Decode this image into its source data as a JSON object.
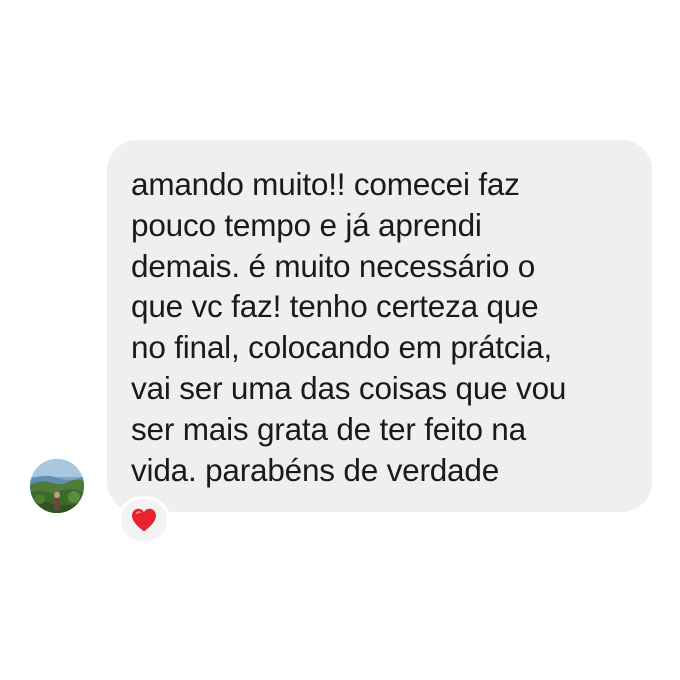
{
  "message": {
    "lines": [
      "amando muito!! comecei faz",
      "pouco tempo e já aprendi",
      "demais. é muito necessário o",
      "que vc faz! tenho certeza que",
      "no final, colocando em prátcia,",
      "vai ser uma das coisas que vou",
      "ser mais grata de ter feito na",
      "vida. parabéns de verdade"
    ],
    "bubble_color": "#efefef",
    "text_color": "#1a1a1a"
  },
  "reaction": {
    "icon": "red-heart-icon",
    "color": "#e8232f"
  },
  "avatar": {
    "icon": "profile-photo-landscape"
  }
}
